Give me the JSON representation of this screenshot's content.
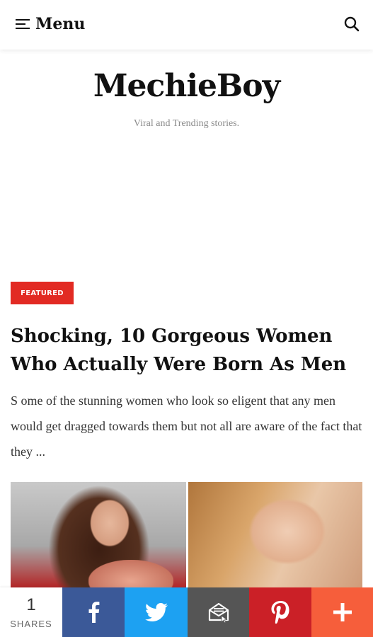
{
  "header": {
    "menu_label": "Menu"
  },
  "site": {
    "title": "MechieBoy",
    "tagline": "Viral and Trending stories."
  },
  "post": {
    "badge": "FEATURED",
    "title": "Shocking, 10 Gorgeous Women Who Actually Were Born As Men",
    "excerpt": "S ome of the stunning women who look so eligent that any men would get dragged towards them but not all are aware of the fact that they ..."
  },
  "share_bar": {
    "count": "1",
    "count_label": "SHARES",
    "buttons": [
      "facebook-icon",
      "twitter-icon",
      "email-icon",
      "pinterest-icon",
      "plus-icon"
    ],
    "colors": {
      "facebook": "#3b5998",
      "twitter": "#1da1f2",
      "email": "#555555",
      "pinterest": "#cb2027",
      "more": "#f65e3b"
    }
  },
  "colors": {
    "badge": "#e22a23"
  }
}
